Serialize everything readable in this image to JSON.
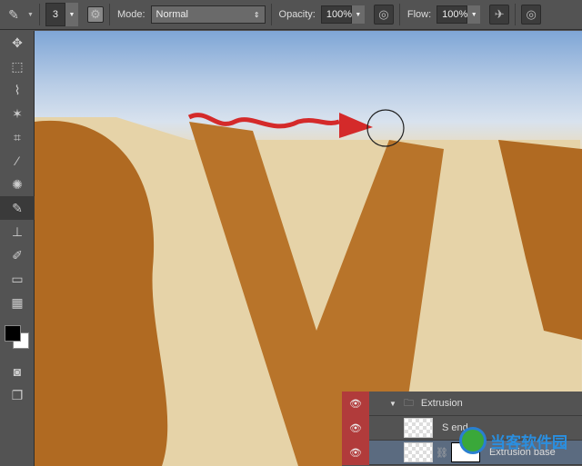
{
  "options_bar": {
    "brush_size": "3",
    "mode_label": "Mode:",
    "mode_value": "Normal",
    "opacity_label": "Opacity:",
    "opacity_value": "100%",
    "flow_label": "Flow:",
    "flow_value": "100%"
  },
  "tools": [
    "move",
    "marquee",
    "lasso",
    "magic-wand",
    "crop",
    "eyedropper",
    "healing",
    "brush",
    "stamp",
    "history-brush",
    "eraser",
    "gradient"
  ],
  "colors": {
    "foreground": "#000000",
    "background": "#ffffff",
    "accent_red": "#d42a2a"
  },
  "layers": [
    {
      "name": "Extrusion",
      "type": "group"
    },
    {
      "name": "S end",
      "type": "layer"
    },
    {
      "name": "Extrusion base",
      "type": "layer"
    }
  ],
  "watermark": "当客软件园"
}
